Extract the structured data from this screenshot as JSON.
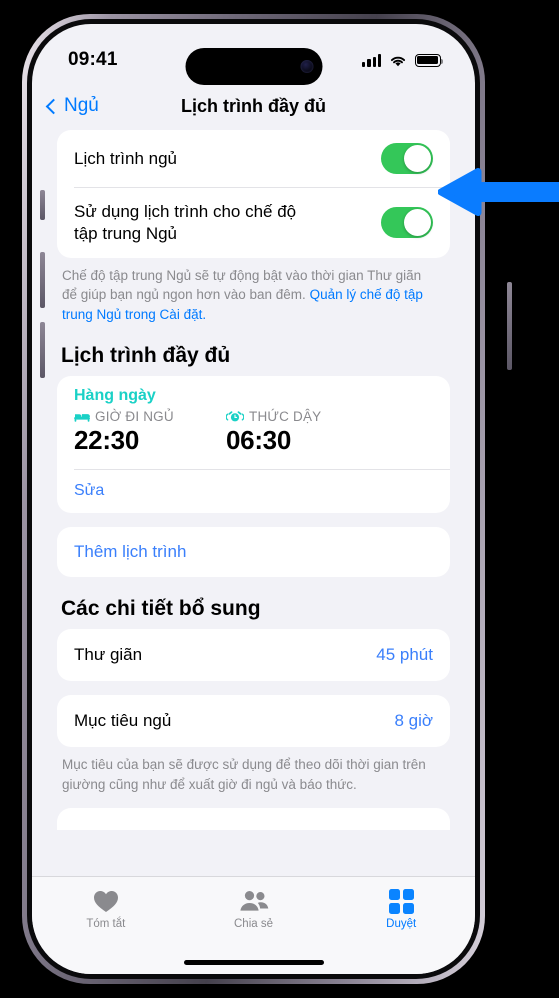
{
  "status_bar": {
    "time": "09:41",
    "signal_icon": "cellular-bars-icon",
    "wifi_icon": "wifi-icon",
    "battery_icon": "battery-icon"
  },
  "nav": {
    "back_label": "Ngủ",
    "back_icon": "chevron-left-icon",
    "title": "Lịch trình đầy đủ"
  },
  "toggles": [
    {
      "label": "Lịch trình ngủ",
      "state": "on"
    },
    {
      "label": "Sử dụng lịch trình cho chế độ tập trung Ngủ",
      "state": "on"
    }
  ],
  "footnote_focus": {
    "text": "Chế độ tập trung Ngủ sẽ tự động bật vào thời gian Thư giãn để giúp bạn ngủ ngon hơn vào ban đêm. ",
    "link": "Quản lý chế độ tập trung Ngủ trong Cài đặt.",
    "trailing": ""
  },
  "full_schedule": {
    "section_title": "Lịch trình đầy đủ",
    "repeat_label": "Hàng ngày",
    "bedtime": {
      "icon": "bed-icon",
      "caption": "GIỜ ĐI NGỦ",
      "time": "22:30"
    },
    "wakeup": {
      "icon": "alarm-clock-icon",
      "caption": "THỨC DẬY",
      "time": "06:30"
    },
    "edit_label": "Sửa",
    "add_label": "Thêm lịch trình"
  },
  "additional_details": {
    "section_title": "Các chi tiết bổ sung",
    "rows": [
      {
        "label": "Thư giãn",
        "value": "45 phút"
      },
      {
        "label": "Mục tiêu ngủ",
        "value": "8 giờ"
      }
    ],
    "footnote": "Mục tiêu của bạn sẽ được sử dụng để theo dõi thời gian trên giường cũng như để xuất giờ đi ngủ và báo thức."
  },
  "tab_bar": [
    {
      "label": "Tóm tắt",
      "icon": "heart-icon",
      "active": false
    },
    {
      "label": "Chia sẻ",
      "icon": "people-icon",
      "active": false
    },
    {
      "label": "Duyệt",
      "icon": "grid-squares-icon",
      "active": true
    }
  ],
  "annotation": {
    "arrow_icon": "left-arrow-annotation",
    "color": "#0a7cff"
  },
  "colors": {
    "accent_blue": "#007aff",
    "link_blue": "#3a7ffb",
    "toggle_green": "#34c759",
    "teal": "#1ad1c6"
  }
}
